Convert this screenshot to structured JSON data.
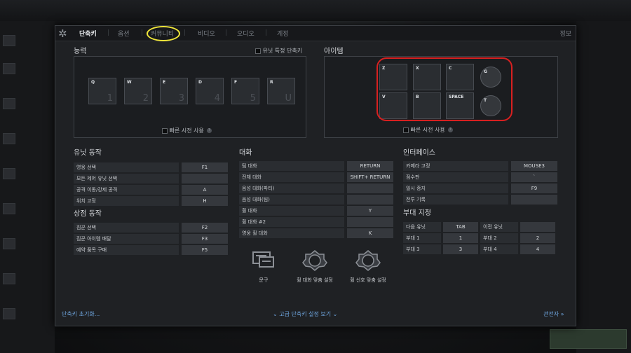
{
  "tabs": [
    "단축키",
    "옵션",
    "커뮤니티",
    "비디오",
    "오디오",
    "계정"
  ],
  "info_label": "정보",
  "abilities": {
    "title": "능력",
    "unit_specific_label": "유닛 특정 단축키",
    "keys": [
      {
        "key": "Q",
        "digit": "1"
      },
      {
        "key": "W",
        "digit": "2"
      },
      {
        "key": "E",
        "digit": "3"
      },
      {
        "key": "D",
        "digit": "4"
      },
      {
        "key": "F",
        "digit": "5"
      },
      {
        "key": "R",
        "digit": "U"
      }
    ],
    "quickcast_label": "빠른 시전 사용"
  },
  "items": {
    "title": "아이템",
    "keys": [
      "Z",
      "X",
      "C",
      "V",
      "B",
      "SPACE"
    ],
    "special_keys": [
      "G",
      "T"
    ],
    "quickcast_label": "빠른 시전 사용"
  },
  "unit_actions": {
    "title": "유닛 동작",
    "rows": [
      {
        "label": "영웅 선택",
        "value": "F1"
      },
      {
        "label": "모든 제어 유닛 선택",
        "value": ""
      },
      {
        "label": "공격 이동/강제 공격",
        "value": "A"
      },
      {
        "label": "위치 고정",
        "value": "H"
      }
    ]
  },
  "shop_actions": {
    "title": "상점 동작",
    "rows": [
      {
        "label": "짐꾼 선택",
        "value": "F2"
      },
      {
        "label": "짐꾼 아이템 배달",
        "value": "F3"
      },
      {
        "label": "예약 품목 구매",
        "value": "F5"
      }
    ]
  },
  "chat": {
    "title": "대화",
    "rows": [
      {
        "label": "팀 대화",
        "value": "RETURN"
      },
      {
        "label": "전체 대화",
        "value": "SHIFT+ RETURN"
      },
      {
        "label": "음성 대화(파티)",
        "value": ""
      },
      {
        "label": "음성 대화(팀)",
        "value": ""
      },
      {
        "label": "휠 대화",
        "value": "Y"
      },
      {
        "label": "휠 대화 #2",
        "value": ""
      },
      {
        "label": "영웅 휠 대화",
        "value": "K"
      }
    ]
  },
  "tools": [
    {
      "label": "문구"
    },
    {
      "label": "휠 대화 맞춤 설정"
    },
    {
      "label": "휠 신호 맞춤 설정"
    }
  ],
  "interface": {
    "title": "인터페이스",
    "rows": [
      {
        "label": "카메라 고정",
        "value": "MOUSE3"
      },
      {
        "label": "점수판",
        "value": "`"
      },
      {
        "label": "일시 중지",
        "value": "F9"
      },
      {
        "label": "전투 기록",
        "value": ""
      }
    ]
  },
  "groups": {
    "title": "부대 지정",
    "rows": [
      {
        "l1": "다음 유닛",
        "v1": "TAB",
        "l2": "이전 유닛",
        "v2": ""
      },
      {
        "l1": "부대 1",
        "v1": "1",
        "l2": "부대 2",
        "v2": "2"
      },
      {
        "l1": "부대 3",
        "v1": "3",
        "l2": "부대 4",
        "v2": "4"
      }
    ]
  },
  "bottom": {
    "reset": "단축키 초기화...",
    "advanced": "고급 단축키 설정 보기",
    "spectator": "관전자"
  },
  "colors": {
    "accent_blue": "#6fa6e0",
    "annotation_yellow": "#f0e63a",
    "annotation_red": "#d82020"
  }
}
